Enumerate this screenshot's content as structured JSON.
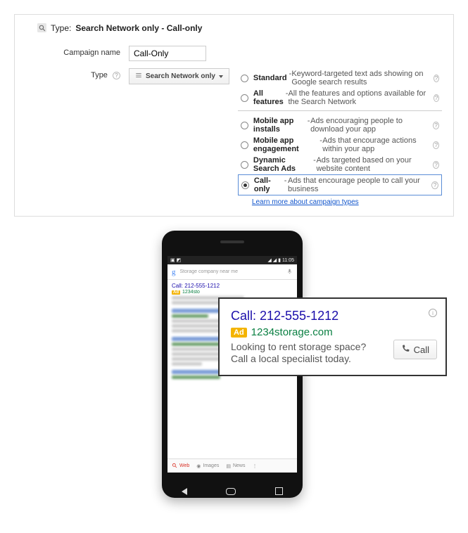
{
  "header": {
    "type_label": "Type:",
    "type_value": "Search Network only - Call-only"
  },
  "campaign": {
    "label": "Campaign name",
    "value": "Call-Only"
  },
  "type_field": {
    "label": "Type",
    "select": "Search Network only"
  },
  "options": {
    "standard": {
      "title": "Standard",
      "desc": "Keyword-targeted text ads showing on Google search results"
    },
    "all": {
      "title": "All features",
      "desc": "All the features and options available for the Search Network"
    },
    "installs": {
      "title": "Mobile app installs",
      "desc": "Ads encouraging people to download your app"
    },
    "engagement": {
      "title": "Mobile app engagement",
      "desc": "Ads that encourage actions within your app"
    },
    "dsa": {
      "title": "Dynamic Search Ads",
      "desc": "Ads targeted based on your website content"
    },
    "callonly": {
      "title": "Call-only",
      "desc": "Ads that encourage people to call your business"
    }
  },
  "learn_more": "Learn more about campaign types",
  "phone": {
    "time": "11:05",
    "search_placeholder": "Storage company near me",
    "ad_call": "Call: 212-555-1212",
    "ad_url_short": "1234sto",
    "ad_badge": "Ad",
    "tabs": {
      "web": "Web",
      "images": "Images",
      "news": "News"
    }
  },
  "callout": {
    "title": "Call: 212-555-1212",
    "ad_badge": "Ad",
    "url": "1234storage.com",
    "desc1": "Looking to rent storage space?",
    "desc2": "Call a local specialist today.",
    "button": "Call"
  }
}
